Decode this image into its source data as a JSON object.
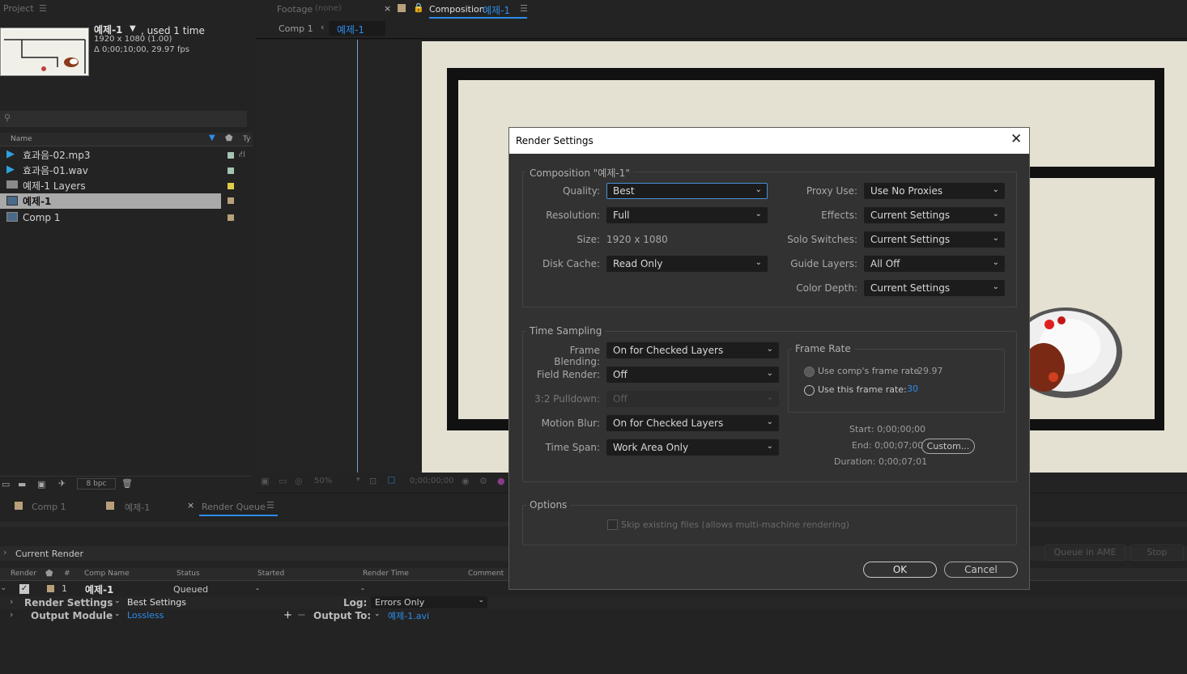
{
  "project": {
    "tab_label": "Project",
    "comp_name": "예제-1",
    "used": ", used 1 time",
    "dims": "1920 x 1080 (1.00)",
    "duration": "Δ 0;00;10;00, 29.97 fps",
    "column_name": "Name",
    "column_type": "Ty",
    "items": [
      {
        "name": "효과음-02.mp3",
        "color": "#a4c4b0"
      },
      {
        "name": "효과음-01.wav",
        "color": "#a4c4b0"
      },
      {
        "name": "예제-1 Layers",
        "color": "#e0cd48"
      },
      {
        "name": "예제-1",
        "color": "#b8a07a"
      },
      {
        "name": "Comp 1",
        "color": "#b8a07a"
      }
    ],
    "bpc": "8 bpc"
  },
  "viewer": {
    "footage_tab": "Footage",
    "footage_none": "(none)",
    "composition_tab": "Composition",
    "composition_name": "예제-1",
    "breadcrumb_prev": "Comp 1",
    "breadcrumb_current": "예제-1",
    "zoom": "50%",
    "timecode": "0;00;00;00"
  },
  "render_queue": {
    "tabs": [
      "Comp 1",
      "예제-1",
      "Render Queue"
    ],
    "current_render": "Current Render",
    "queue_in_ame": "Queue in AME",
    "stop": "Stop",
    "columns": [
      "Render",
      "#",
      "Comp Name",
      "Status",
      "Started",
      "Render Time",
      "Comment"
    ],
    "item": {
      "number": "1",
      "comp_name": "예제-1",
      "status": "Queued",
      "started": "-",
      "render_time": "-"
    },
    "render_settings_label": "Render Settings",
    "render_settings_value": "Best Settings",
    "output_module_label": "Output Module",
    "output_module_value": "Lossless",
    "log_label": "Log:",
    "log_value": "Errors Only",
    "output_to_label": "Output To:",
    "output_to_value": "예제-1.avi"
  },
  "dialog": {
    "title": "Render Settings",
    "composition_group": "Composition \"예제-1\"",
    "quality_label": "Quality:",
    "quality_value": "Best",
    "resolution_label": "Resolution:",
    "resolution_value": "Full",
    "size_label": "Size:",
    "size_value": "1920 x 1080",
    "disk_cache_label": "Disk Cache:",
    "disk_cache_value": "Read Only",
    "proxy_label": "Proxy Use:",
    "proxy_value": "Use No Proxies",
    "effects_label": "Effects:",
    "effects_value": "Current Settings",
    "solo_label": "Solo Switches:",
    "solo_value": "Current Settings",
    "guide_label": "Guide Layers:",
    "guide_value": "All Off",
    "color_depth_label": "Color Depth:",
    "color_depth_value": "Current Settings",
    "time_sampling_group": "Time Sampling",
    "frame_blending_label": "Frame Blending:",
    "frame_blending_value": "On for Checked Layers",
    "field_render_label": "Field Render:",
    "field_render_value": "Off",
    "pulldown_label": "3:2 Pulldown:",
    "pulldown_value": "Off",
    "motion_blur_label": "Motion Blur:",
    "motion_blur_value": "On for Checked Layers",
    "time_span_label": "Time Span:",
    "time_span_value": "Work Area Only",
    "frame_rate_group": "Frame Rate",
    "use_comp_rate": "Use comp's frame rate",
    "comp_rate_value": "29.97",
    "use_this_rate": "Use this frame rate:",
    "this_rate_value": "30",
    "start_text": "Start: 0;00;00;00",
    "end_text": "End: 0;00;07;00",
    "duration_text": "Duration: 0;00;07;01",
    "custom_button": "Custom...",
    "options_group": "Options",
    "skip_files": "Skip existing files (allows multi-machine rendering)",
    "ok": "OK",
    "cancel": "Cancel"
  }
}
